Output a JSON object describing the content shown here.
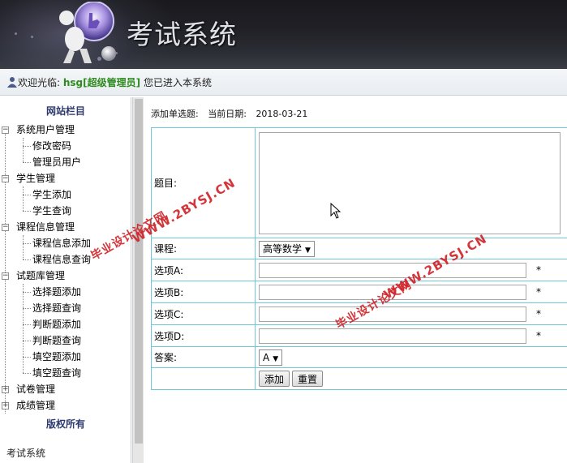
{
  "header": {
    "title": "考试系统"
  },
  "welcome": {
    "prefix": "欢迎光临:",
    "username": "hsg[超级管理员]",
    "suffix": "您已进入本系统"
  },
  "sidebar": {
    "heading": "网站栏目",
    "footer_heading": "版权所有",
    "footer_text": "考试系统",
    "groups": [
      {
        "label": "系统用户管理",
        "toggle": "−",
        "children": [
          "修改密码",
          "管理员用户"
        ]
      },
      {
        "label": "学生管理",
        "toggle": "−",
        "children": [
          "学生添加",
          "学生查询"
        ]
      },
      {
        "label": "课程信息管理",
        "toggle": "−",
        "children": [
          "课程信息添加",
          "课程信息查询"
        ]
      },
      {
        "label": "试题库管理",
        "toggle": "−",
        "children": [
          "选择题添加",
          "选择题查询",
          "判断题添加",
          "判断题查询",
          "填空题添加",
          "填空题查询"
        ]
      },
      {
        "label": "试卷管理",
        "toggle": "+",
        "children": []
      },
      {
        "label": "成绩管理",
        "toggle": "+",
        "children": []
      }
    ]
  },
  "main": {
    "page_title": "添加单选题:",
    "date_label": "当前日期:",
    "date_value": "2018-03-21",
    "form": {
      "question_label": "题目:",
      "question_value": "",
      "course_label": "课程:",
      "course_value": "高等数学",
      "option_a_label": "选项A:",
      "option_b_label": "选项B:",
      "option_c_label": "选项C:",
      "option_d_label": "选项D:",
      "required_mark": "*",
      "answer_label": "答案:",
      "answer_value": "A",
      "add_button": "添加",
      "reset_button": "重置"
    }
  },
  "watermark": {
    "line1": "毕业设计论文网",
    "line2": "WWW.2BYSJ.CN",
    "color": "#d0252a"
  }
}
